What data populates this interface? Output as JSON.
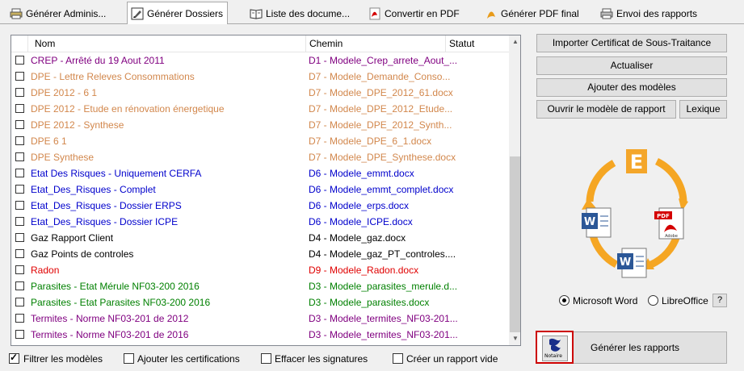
{
  "tabs": [
    {
      "label": "Générer Adminis...",
      "icon": "printer-icon"
    },
    {
      "label": "Générer Dossiers",
      "icon": "edit-document-icon",
      "active": true
    },
    {
      "label": "Liste des docume...",
      "icon": "book-icon"
    },
    {
      "label": "Convertir en PDF",
      "icon": "pdf-icon"
    },
    {
      "label": "Générer PDF final",
      "icon": "pdf-final-icon"
    },
    {
      "label": "Envoi des rapports",
      "icon": "printer-icon"
    }
  ],
  "list": {
    "columns": {
      "name": "Nom",
      "path": "Chemin",
      "status": "Statut"
    },
    "rows": [
      {
        "name": "CREP - Arrêté du 19 Aout 2011",
        "path": "D1 - Modele_Crep_arrete_Aout_...",
        "color": "#800080"
      },
      {
        "name": "DPE - Lettre Releves Consommations",
        "path": "D7 - Modele_Demande_Conso...",
        "color": "#d2874c"
      },
      {
        "name": "DPE 2012 - 6 1",
        "path": "D7 - Modele_DPE_2012_61.docx",
        "color": "#d2874c"
      },
      {
        "name": "DPE 2012 - Etude en rénovation énergetique",
        "path": "D7 - Modele_DPE_2012_Etude...",
        "color": "#d2874c"
      },
      {
        "name": "DPE 2012 - Synthese",
        "path": "D7 - Modele_DPE_2012_Synth...",
        "color": "#d2874c"
      },
      {
        "name": "DPE 6 1",
        "path": "D7 - Modele_DPE_6_1.docx",
        "color": "#d2874c"
      },
      {
        "name": "DPE Synthese",
        "path": "D7 - Modele_DPE_Synthese.docx",
        "color": "#d2874c"
      },
      {
        "name": "Etat Des Risques - Uniquement CERFA",
        "path": "D6 - Modele_emmt.docx",
        "color": "#0000cc"
      },
      {
        "name": "Etat_Des_Risques - Complet",
        "path": "D6 - Modele_emmt_complet.docx",
        "color": "#0000cc"
      },
      {
        "name": "Etat_Des_Risques - Dossier ERPS",
        "path": "D6 - Modele_erps.docx",
        "color": "#0000cc"
      },
      {
        "name": "Etat_Des_Risques - Dossier ICPE",
        "path": "D6 - Modele_ICPE.docx",
        "color": "#0000cc"
      },
      {
        "name": "Gaz  Rapport Client",
        "path": "D4 - Modele_gaz.docx",
        "color": "#000000"
      },
      {
        "name": "Gaz Points de controles",
        "path": "D4 - Modele_gaz_PT_controles....",
        "color": "#000000"
      },
      {
        "name": "Radon",
        "path": "D9 - Modele_Radon.docx",
        "color": "#e00000"
      },
      {
        "name": "Parasites - Etat Mérule NF03-200 2016",
        "path": "D3 - Modele_parasites_merule.d...",
        "color": "#008000"
      },
      {
        "name": "Parasites - Etat Parasites NF03-200 2016",
        "path": "D3 - Modele_parasites.docx",
        "color": "#008000"
      },
      {
        "name": "Termites - Norme NF03-201 de 2012",
        "path": "D3 - Modele_termites_NF03-201...",
        "color": "#800080"
      },
      {
        "name": "Termites - Norme NF03-201 de 2016",
        "path": "D3 - Modele_termites_NF03-201...",
        "color": "#800080"
      }
    ]
  },
  "buttons": {
    "import_cert": "Importer Certificat de Sous-Traitance",
    "refresh": "Actualiser",
    "add_models": "Ajouter des modèles",
    "open_model": "Ouvrir le modèle de rapport",
    "lexicon": "Lexique",
    "generate": "Générer les rapports"
  },
  "office": {
    "word": "Microsoft Word",
    "libre": "LibreOffice",
    "help": "?",
    "selected": "word"
  },
  "notaire_label": "Notaire",
  "options": {
    "filter": {
      "label": "Filtrer les modèles",
      "checked": true
    },
    "certs": {
      "label": "Ajouter les certifications",
      "checked": false
    },
    "signatures": {
      "label": "Effacer les signatures",
      "checked": false
    },
    "empty": {
      "label": "Créer un rapport vide",
      "checked": false
    }
  },
  "graphic_letters": {
    "center": "E",
    "pdf": "PDF",
    "adobe": "Adobe",
    "word": "W"
  },
  "colors": {
    "accent": "#0078d7",
    "highlight": "#cc0000"
  }
}
